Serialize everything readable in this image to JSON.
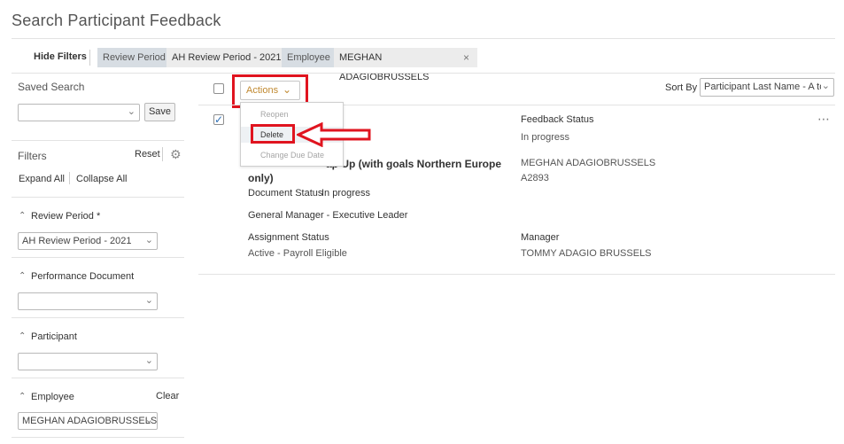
{
  "page": {
    "title": "Search Participant Feedback"
  },
  "filter_bar": {
    "hide_filters": "Hide Filters",
    "chips": [
      {
        "key": "Review Period",
        "value": "AH Review Period - 2021"
      },
      {
        "key": "Employee",
        "value": "MEGHAN ADAGIOBRUSSELS"
      }
    ],
    "remove_icon": "×"
  },
  "saved_search": {
    "heading": "Saved Search",
    "value": "",
    "save_label": "Save"
  },
  "filters": {
    "heading": "Filters",
    "reset_label": "Reset",
    "expand_all": "Expand All",
    "collapse_all": "Collapse All",
    "sections": [
      {
        "label": "Review Period *",
        "value": "AH Review Period - 2021"
      },
      {
        "label": "Performance Document",
        "value": ""
      },
      {
        "label": "Participant",
        "value": ""
      },
      {
        "label": "Employee",
        "value": "MEGHAN ADAGIOBRUSSELS",
        "clear_label": "Clear"
      }
    ]
  },
  "toolbar": {
    "actions_label": "Actions",
    "sort_by_label": "Sort By",
    "sort_value": "Participant Last Name - A to Z"
  },
  "actions_menu": {
    "items": [
      {
        "label": "Reopen",
        "enabled": false
      },
      {
        "label": "Delete",
        "enabled": true
      },
      {
        "label": "Change Due Date",
        "enabled": false
      }
    ]
  },
  "result": {
    "checked": true,
    "title_line1": "ap Up (with goals Northern Europe",
    "title_line2": "only)",
    "document_status_label": "Document Status",
    "document_status_value": "In progress",
    "role": "General Manager - Executive Leader",
    "assignment_status_label": "Assignment Status",
    "assignment_status_value": "Active - Payroll Eligible",
    "feedback_status_label": "Feedback Status",
    "feedback_status_value": "In progress",
    "employee_name": "MEGHAN ADAGIOBRUSSELS",
    "employee_number": "A2893",
    "manager_label": "Manager",
    "manager_value": "TOMMY ADAGIO BRUSSELS"
  },
  "colors": {
    "annotation_red": "#e0141f",
    "actions_accent": "#c08930",
    "check_blue": "#2d6fb6",
    "chip_key_bg": "#d7dde3"
  }
}
